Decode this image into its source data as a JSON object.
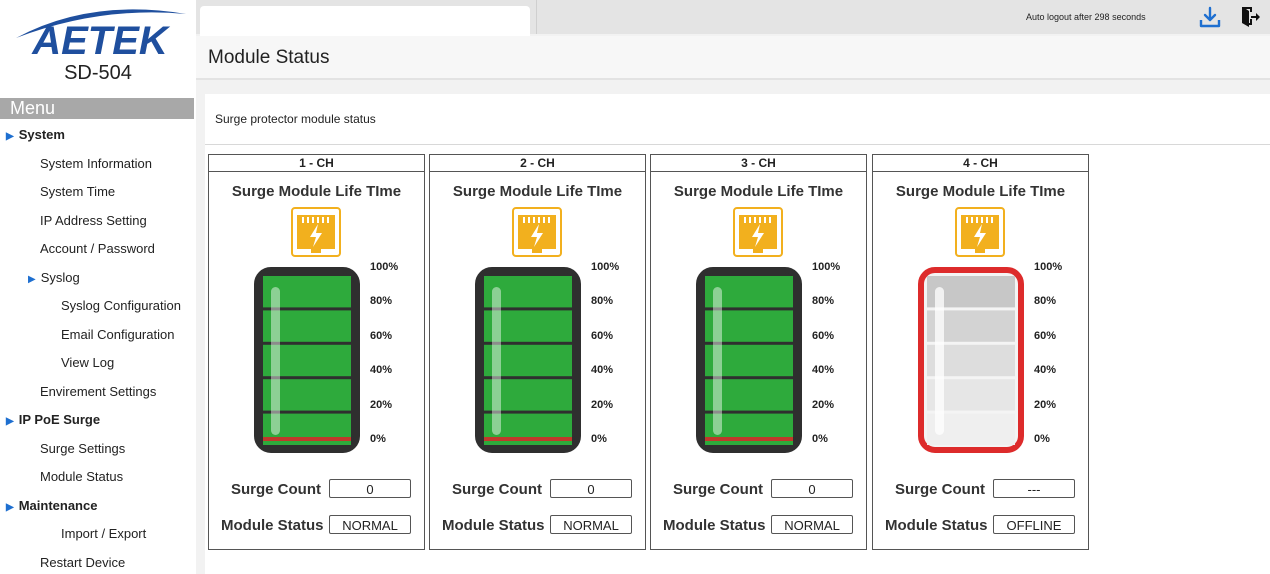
{
  "brand": {
    "logo_text": "AETEK",
    "model": "SD-504"
  },
  "menu": {
    "title": "Menu",
    "items": [
      {
        "label": "System",
        "level": 0
      },
      {
        "label": "System Information",
        "level": 1
      },
      {
        "label": "System Time",
        "level": 1
      },
      {
        "label": "IP Address Setting",
        "level": 1
      },
      {
        "label": "Account / Password",
        "level": 1
      },
      {
        "label": "Syslog",
        "level": 1
      },
      {
        "label": "Syslog Configuration",
        "level": 2
      },
      {
        "label": "Email Configuration",
        "level": 2
      },
      {
        "label": "View Log",
        "level": 2
      },
      {
        "label": "Envirement Settings",
        "level": 1
      },
      {
        "label": "IP PoE Surge",
        "level": 0
      },
      {
        "label": "Surge Settings",
        "level": 1
      },
      {
        "label": "Module Status",
        "level": 1
      },
      {
        "label": "Maintenance",
        "level": 0
      },
      {
        "label": "Import / Export",
        "level": 2
      },
      {
        "label": "Restart Device",
        "level": 1
      }
    ]
  },
  "topbar": {
    "auto_logout": "Auto logout after  298 seconds",
    "download_icon": "download-icon",
    "logout_icon": "logout-icon"
  },
  "page": {
    "title": "Module Status",
    "section_title": "Surge protector module status"
  },
  "module_labels": {
    "life_title": "Surge Module Life TIme",
    "surge_count": "Surge Count",
    "module_status": "Module Status"
  },
  "life_scale": [
    "100%",
    "80%",
    "60%",
    "40%",
    "20%",
    "0%"
  ],
  "colors": {
    "healthy": "#2eaa3c",
    "offline_border": "#dd2b2b",
    "accent_icon": "#f2b01e",
    "menu_arrow": "#1e6fd0"
  },
  "modules": [
    {
      "channel": "1  - CH",
      "surge_count": "0",
      "status": "NORMAL",
      "life_percent": 100
    },
    {
      "channel": "2  - CH",
      "surge_count": "0",
      "status": "NORMAL",
      "life_percent": 100
    },
    {
      "channel": "3  - CH",
      "surge_count": "0",
      "status": "NORMAL",
      "life_percent": 100
    },
    {
      "channel": "4  - CH",
      "surge_count": "---",
      "status": "OFFLINE",
      "life_percent": 0
    }
  ]
}
